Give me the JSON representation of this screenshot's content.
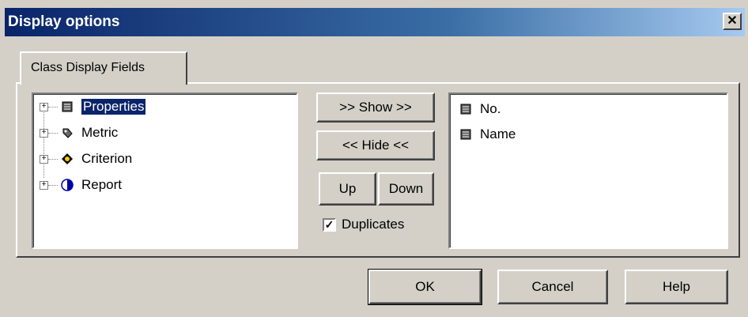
{
  "window": {
    "title": "Display options",
    "close_label": "✕"
  },
  "tabs": [
    {
      "label": "Class Display Fields",
      "active": true
    }
  ],
  "tree": {
    "items": [
      {
        "label": "Properties",
        "icon": "properties-icon",
        "expander": "+",
        "selected": true
      },
      {
        "label": "Metric",
        "icon": "metric-icon",
        "expander": "+",
        "selected": false
      },
      {
        "label": "Criterion",
        "icon": "criterion-icon",
        "expander": "+",
        "selected": false
      },
      {
        "label": "Report",
        "icon": "report-icon",
        "expander": "+",
        "selected": false
      }
    ]
  },
  "transfer": {
    "show_label": ">> Show >>",
    "hide_label": "<< Hide <<",
    "up_label": "Up",
    "down_label": "Down",
    "duplicates_label": "Duplicates",
    "duplicates_checked": true,
    "check_mark": "✓"
  },
  "shown_fields": {
    "items": [
      {
        "label": "No.",
        "icon": "field-icon"
      },
      {
        "label": "Name",
        "icon": "field-icon"
      }
    ]
  },
  "footer": {
    "ok_label": "OK",
    "cancel_label": "Cancel",
    "help_label": "Help"
  },
  "colors": {
    "face": "#d4d0c8",
    "title_start": "#0a246a",
    "title_end": "#a6caf0",
    "selection": "#0a246a"
  }
}
